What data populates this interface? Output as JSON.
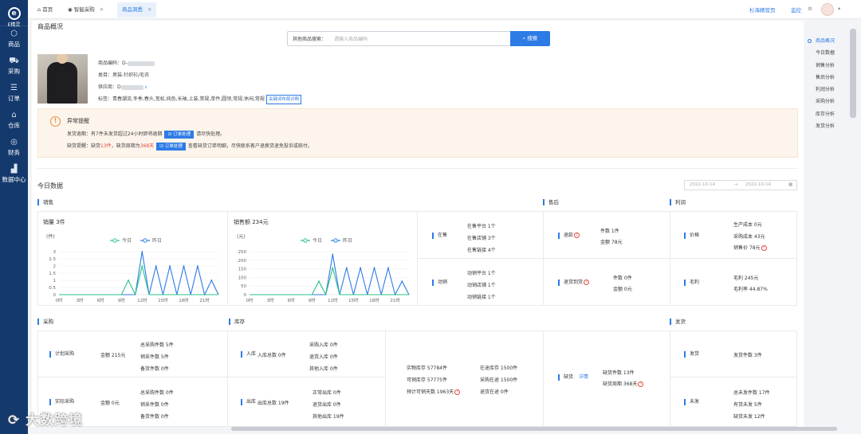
{
  "sidebar": {
    "brand": "E精灵",
    "items": [
      {
        "label": "商品",
        "icon": "cube-icon"
      },
      {
        "label": "采购",
        "icon": "cart-icon"
      },
      {
        "label": "订单",
        "icon": "list-icon"
      },
      {
        "label": "仓库",
        "icon": "home-icon"
      },
      {
        "label": "财务",
        "icon": "coin-icon"
      },
      {
        "label": "数据中心",
        "icon": "chart-icon"
      }
    ]
  },
  "topbar": {
    "tabs": [
      {
        "label": "首页"
      },
      {
        "label": "智能采购"
      },
      {
        "label": "商品洞悉"
      }
    ],
    "right_links": [
      "杉海精营页",
      "监控"
    ]
  },
  "page": {
    "title": "商品概况",
    "search": {
      "label": "其他商品搜索：",
      "placeholder": "请输入商品编码",
      "button": "搜索"
    },
    "product": {
      "code_label": "商品编码：D-",
      "category": "类目：男装-针织衫/毛衣",
      "supplier_label": "供应商：D",
      "tags": "标签：青春潮流,冬季,春头,宽松,纯色,长袖,上装,常规,单件,圆领,常规,休闲,常规",
      "tags_button": "关键词布局诊断"
    },
    "alert": {
      "title": "异常提醒",
      "line1_pre": "发货逾期：有7件未发货超过24小时即将逾期",
      "line1_btn": "订单处理",
      "line1_post": "请尽快处理。",
      "line2_a": "缺货提醒：缺货",
      "line2_b": "13件",
      "line2_c": "，缺货周期为",
      "line2_d": "368天",
      "line2_btn": "订单处理",
      "line2_post": "查看缺货订单明细，尽快联系客户退换货退免投诉或赔付。"
    }
  },
  "today": {
    "title": "今日数据",
    "date_from": "2022-10-14",
    "date_to": "2022-10-14"
  },
  "sales": {
    "title": "销售",
    "online": {
      "label": "在售",
      "lines": [
        "在售平台 1个",
        "在售店铺 3个",
        "在售链接 4个"
      ]
    },
    "moving": {
      "label": "动销",
      "lines": [
        "动销平台 1个",
        "动销店铺 1个",
        "动销链接 1个"
      ]
    }
  },
  "aftersale": {
    "title": "售后",
    "refund": {
      "label": "退款",
      "lines": [
        "件数 1件",
        "金额 78元"
      ]
    },
    "return": {
      "label": "退货到货",
      "lines": [
        "件数 0件",
        "金额 0元"
      ]
    }
  },
  "profit": {
    "title": "利润",
    "price": {
      "label": "价格",
      "lines": [
        "生产成本 0元",
        "采购成本 43元",
        "销售价 78元"
      ]
    },
    "gross": {
      "label": "毛利",
      "lines": [
        "毛利 245元",
        "毛利率 44.87%"
      ]
    }
  },
  "purchase": {
    "title": "采购",
    "plan": {
      "label": "计划采购",
      "amount": "金额 215元",
      "lines": [
        "总采购件数 5件",
        "销采件数 5件",
        "备货件数 0件"
      ]
    },
    "actual": {
      "label": "实际采购",
      "amount": "金额 0元",
      "lines": [
        "总采购件数 0件",
        "销采件数 0件",
        "备货件数 0件"
      ]
    }
  },
  "stock": {
    "title": "库存",
    "in": {
      "label": "入库",
      "total": "入库总数 0件",
      "lines": [
        "采购入库 0件",
        "退货入库 0件",
        "其他入库 0件"
      ]
    },
    "out": {
      "label": "出库",
      "total": "出库总数 19件",
      "lines": [
        "正常出库 0件",
        "退货出库 0件",
        "其他出库 19件"
      ]
    },
    "summary_left": [
      "实物库存 57784件",
      "可销库存 57775件",
      "预计可销天数 1963天"
    ],
    "summary_right": [
      "在途库存 1500件",
      "采购在途 1500件",
      "退货在途 0件"
    ],
    "shortage": {
      "label": "缺货",
      "link": "详情",
      "lines": [
        "缺货件数 13件",
        "缺货周期 368天"
      ]
    }
  },
  "shipping": {
    "title": "发货",
    "ship": {
      "label": "发货",
      "lines": [
        "发货件数 3件"
      ]
    },
    "unship": {
      "label": "未发",
      "lines": [
        "总未发件数 17件",
        "有货未发 5件",
        "缺货未发 12件"
      ]
    }
  },
  "right_nav": [
    "商品概况",
    "今日数据",
    "销售分析",
    "售后分析",
    "利润分析",
    "采购分析",
    "库存分析",
    "发货分析"
  ],
  "watermark": "大数跨境",
  "colors": {
    "accent": "#2d7be5",
    "today_line": "#28c28a",
    "yesterday_line": "#2d7be5",
    "sidebar": "#14396d"
  },
  "chart_data": [
    {
      "type": "line",
      "title": "销量 3件",
      "ylabel": "(件)",
      "x": [
        "0时",
        "1时",
        "2时",
        "3时",
        "4时",
        "5时",
        "6时",
        "7时",
        "8时",
        "9时",
        "10时",
        "11时",
        "12时",
        "13时",
        "14时",
        "15时",
        "16时",
        "17时",
        "18时",
        "19时",
        "20时",
        "21时",
        "22时",
        "23时"
      ],
      "xticks": [
        "0时",
        "3时",
        "6时",
        "9时",
        "12时",
        "15时",
        "18时",
        "21时"
      ],
      "yticks": [
        "0",
        "0.5",
        "1",
        "1.5",
        "2",
        "2.5",
        "3"
      ],
      "ylim": [
        0,
        3
      ],
      "legend": "top",
      "series": [
        {
          "name": "今日",
          "values": [
            0,
            0,
            0,
            0,
            0,
            0,
            0,
            0,
            0,
            0,
            1,
            0,
            2,
            0,
            0,
            0,
            0,
            0,
            0,
            0,
            0,
            0,
            0,
            0
          ]
        },
        {
          "name": "昨日",
          "values": [
            0,
            0,
            0,
            0,
            0,
            0,
            0,
            0,
            0,
            0,
            0,
            0,
            3,
            0,
            2,
            0,
            2,
            0,
            2,
            0,
            2,
            0,
            1,
            0
          ]
        }
      ]
    },
    {
      "type": "line",
      "title": "销售额 234元",
      "ylabel": "(元)",
      "x": [
        "0时",
        "1时",
        "2时",
        "3时",
        "4时",
        "5时",
        "6时",
        "7时",
        "8时",
        "9时",
        "10时",
        "11时",
        "12时",
        "13时",
        "14时",
        "15时",
        "16时",
        "17时",
        "18时",
        "19时",
        "20时",
        "21时",
        "22时",
        "23时"
      ],
      "xticks": [
        "0时",
        "3时",
        "6时",
        "9时",
        "12时",
        "15时",
        "18时",
        "21时"
      ],
      "yticks": [
        "0",
        "50",
        "100",
        "150",
        "200",
        "250"
      ],
      "ylim": [
        0,
        250
      ],
      "legend": "top",
      "series": [
        {
          "name": "今日",
          "values": [
            0,
            0,
            0,
            0,
            0,
            0,
            0,
            0,
            0,
            0,
            78,
            0,
            156,
            0,
            0,
            0,
            0,
            0,
            0,
            0,
            0,
            0,
            0,
            0
          ]
        },
        {
          "name": "昨日",
          "values": [
            0,
            0,
            0,
            0,
            0,
            0,
            0,
            0,
            0,
            0,
            0,
            0,
            234,
            0,
            156,
            0,
            156,
            0,
            156,
            0,
            156,
            0,
            78,
            0
          ]
        }
      ]
    }
  ]
}
